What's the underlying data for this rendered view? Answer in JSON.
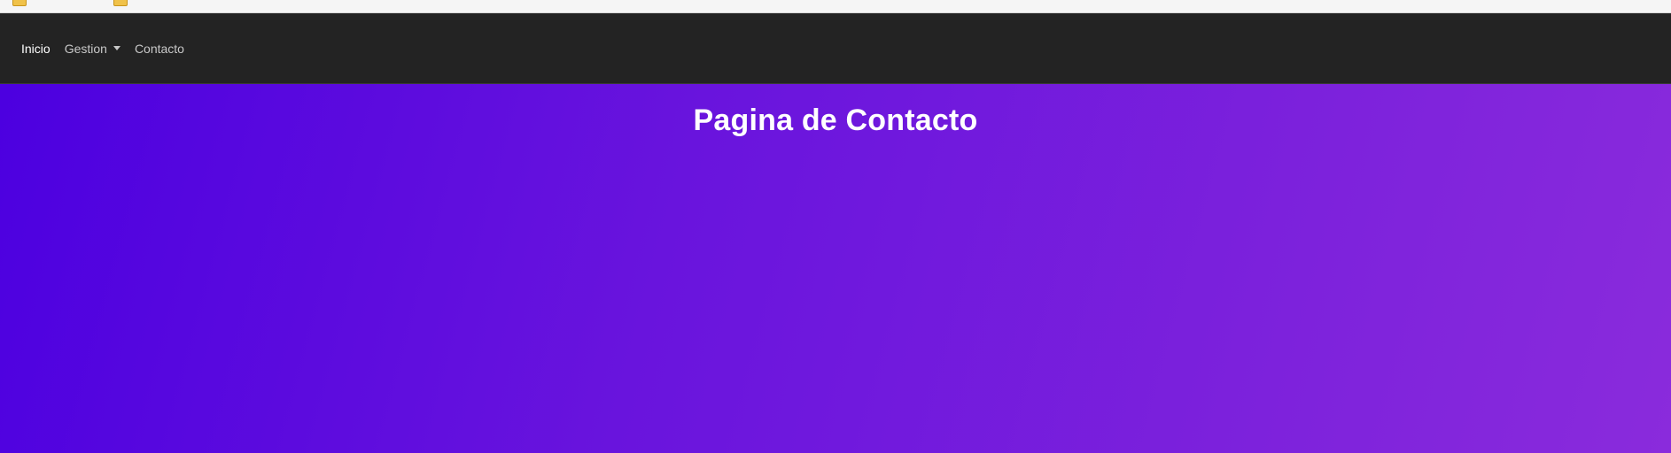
{
  "bookmarks": [
    {
      "label": "",
      "icon": "folder-icon"
    },
    {
      "label": "",
      "icon": "folder-icon"
    }
  ],
  "navbar": {
    "items": [
      {
        "label": "Inicio",
        "active": true
      },
      {
        "label": "Gestion",
        "dropdown": true
      },
      {
        "label": "Contacto"
      }
    ]
  },
  "main": {
    "title": "Pagina de Contacto"
  },
  "colors": {
    "navbar_bg": "#232323",
    "gradient_start": "#4c00e0",
    "gradient_end": "#8a2bdc"
  }
}
